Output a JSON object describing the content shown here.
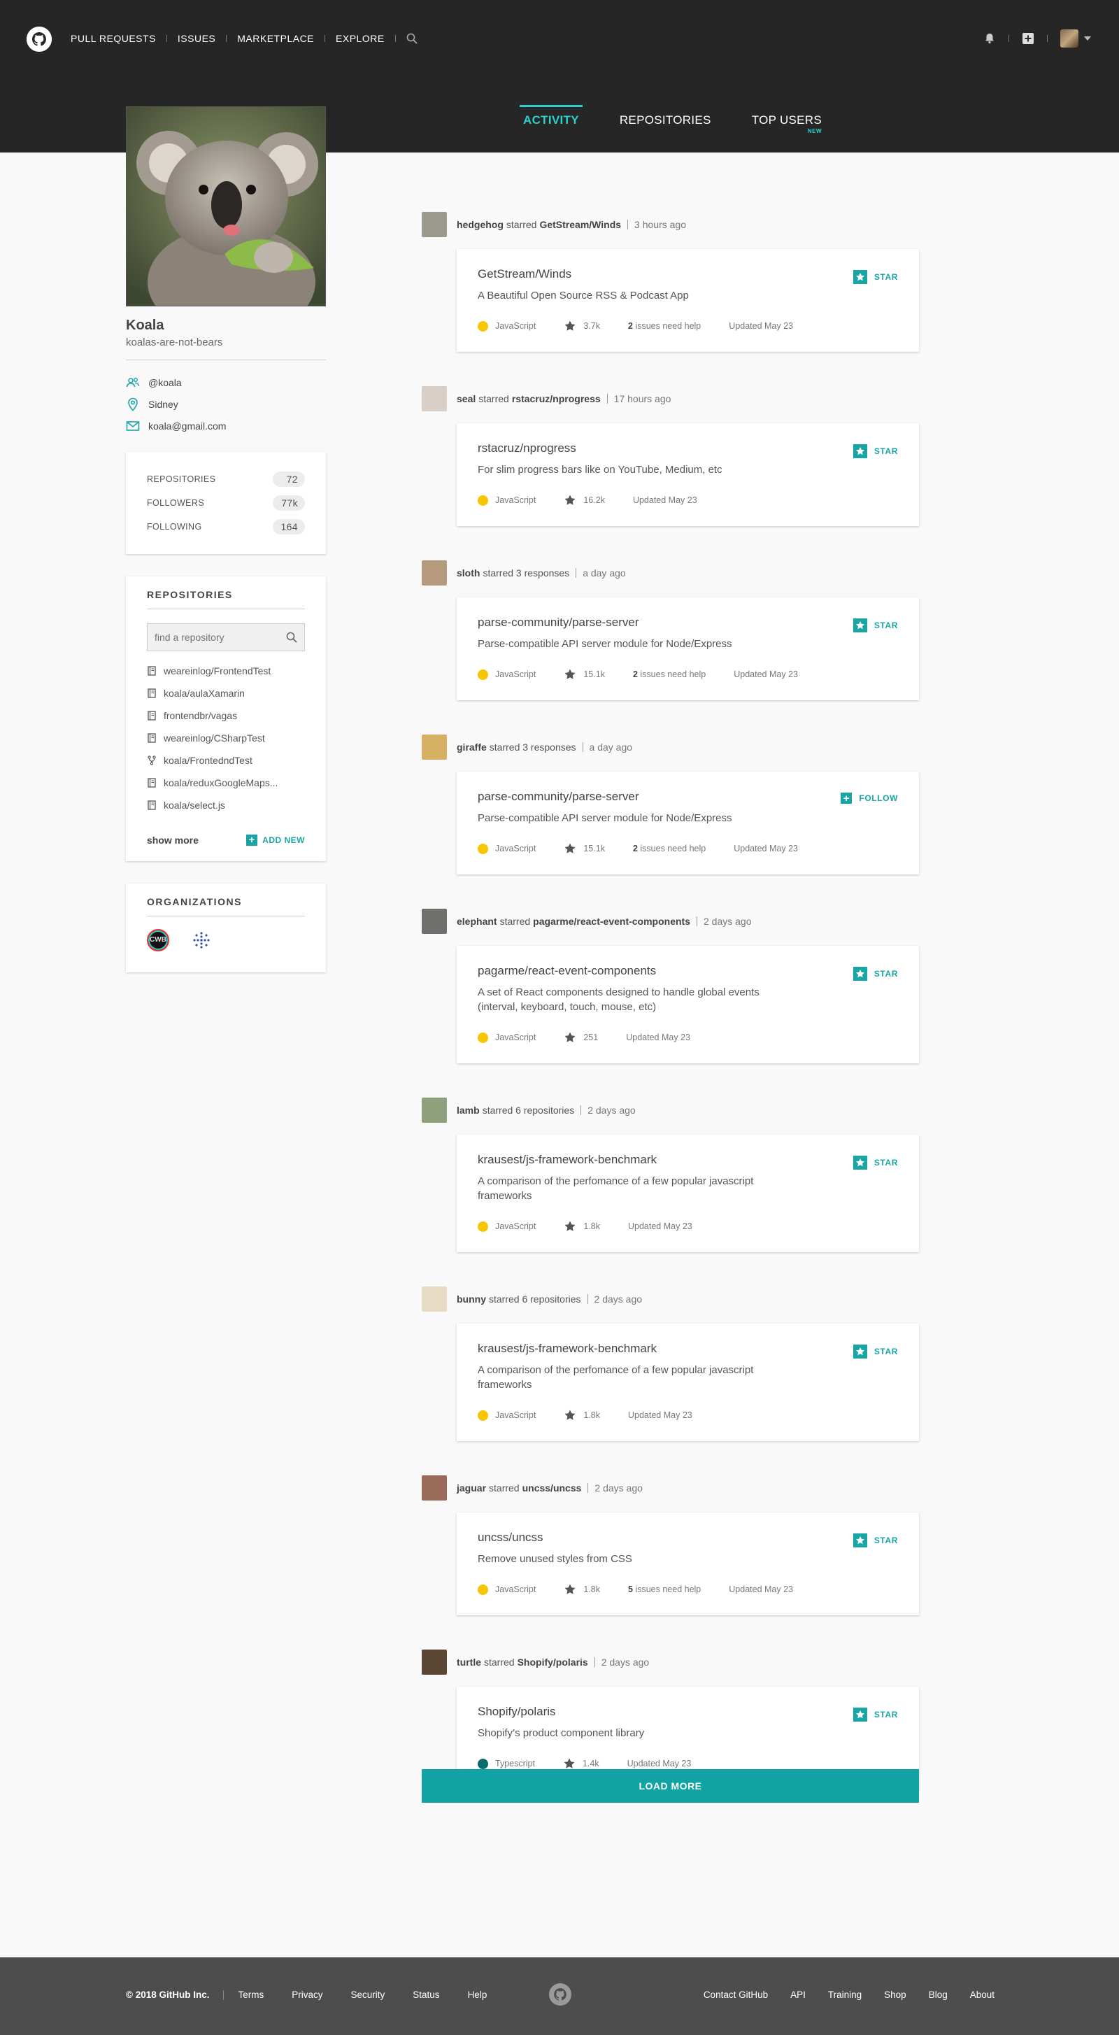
{
  "nav": {
    "items": [
      "PULL REQUESTS",
      "ISSUES",
      "MARKETPLACE",
      "EXPLORE"
    ]
  },
  "tabs": [
    {
      "label": "ACTIVITY",
      "active": true
    },
    {
      "label": "REPOSITORIES"
    },
    {
      "label": "TOP USERS",
      "badge": "NEW"
    }
  ],
  "profile": {
    "name": "Koala",
    "handle": "koalas-are-not-bears",
    "username": "@koala",
    "location": "Sidney",
    "email": "koala@gmail.com"
  },
  "stats": [
    {
      "label": "REPOSITORIES",
      "value": "72"
    },
    {
      "label": "FOLLOWERS",
      "value": "77k"
    },
    {
      "label": "FOLLOWING",
      "value": "164"
    }
  ],
  "repos": {
    "title": "REPOSITORIES",
    "search_placeholder": "find a repository",
    "items": [
      {
        "name": "weareinlog/FrontendTest",
        "icon": "repo-icon"
      },
      {
        "name": "koala/aulaXamarin",
        "icon": "repo-icon"
      },
      {
        "name": "frontendbr/vagas",
        "icon": "repo-icon"
      },
      {
        "name": "weareinlog/CSharpTest",
        "icon": "repo-icon"
      },
      {
        "name": "koala/FrontedndTest",
        "icon": "fork-icon"
      },
      {
        "name": "koala/reduxGoogleMaps...",
        "icon": "repo-icon"
      },
      {
        "name": "koala/select.js",
        "icon": "repo-icon"
      }
    ],
    "show_more": "show more",
    "add_new": "ADD NEW"
  },
  "orgs": {
    "title": "ORGANIZATIONS",
    "items": [
      "CWB"
    ]
  },
  "feed": [
    {
      "user": "hedgehog",
      "verb": "starred",
      "target": "GetStream/Winds",
      "time": "3 hours ago",
      "avatar_color": "#9a9a8c",
      "repo": "GetStream/Winds",
      "desc": "A Beautiful Open Source RSS & Podcast App",
      "lang": "JavaScript",
      "lang_color": "#f7c600",
      "stars": "3.7k",
      "issues": "2",
      "issues_text": "issues need help",
      "updated": "Updated May 23",
      "action": "STAR"
    },
    {
      "user": "seal",
      "verb": "starred",
      "target": "rstacruz/nprogress",
      "time": "17 hours ago",
      "avatar_color": "#d9cfc6",
      "repo": "rstacruz/nprogress",
      "desc": "For slim progress bars like on YouTube, Medium, etc",
      "lang": "JavaScript",
      "lang_color": "#f7c600",
      "stars": "16.2k",
      "issues": "",
      "issues_text": "",
      "updated": "Updated May 23",
      "action": "STAR"
    },
    {
      "user": "sloth",
      "verb": "starred 3 responses",
      "target": "",
      "time": "a day ago",
      "avatar_color": "#b59a7e",
      "repo": "parse-community/parse-server",
      "desc": "Parse-compatible API server module for Node/Express",
      "lang": "JavaScript",
      "lang_color": "#f7c600",
      "stars": "15.1k",
      "issues": "2",
      "issues_text": "issues need help",
      "updated": "Updated May 23",
      "action": "STAR"
    },
    {
      "user": "giraffe",
      "verb": "starred 3 responses",
      "target": "",
      "time": "a day ago",
      "avatar_color": "#d6b163",
      "repo": "parse-community/parse-server",
      "desc": "Parse-compatible API server module for Node/Express",
      "lang": "JavaScript",
      "lang_color": "#f7c600",
      "stars": "15.1k",
      "issues": "2",
      "issues_text": "issues need help",
      "updated": "Updated May 23",
      "action": "FOLLOW"
    },
    {
      "user": "elephant",
      "verb": "starred",
      "target": "pagarme/react-event-components",
      "time": "2 days ago",
      "avatar_color": "#6f6f6b",
      "repo": "pagarme/react-event-components",
      "desc": "A set of React components designed to handle global events (interval, keyboard, touch, mouse, etc)",
      "lang": "JavaScript",
      "lang_color": "#f7c600",
      "stars": "251",
      "issues": "",
      "issues_text": "",
      "updated": "Updated May 23",
      "action": "STAR"
    },
    {
      "user": "lamb",
      "verb": "starred 6 repositories",
      "target": "",
      "time": "2 days ago",
      "avatar_color": "#8ea07c",
      "repo": "krausest/js-framework-benchmark",
      "desc": "A comparison of the perfomance of a few popular javascript frameworks",
      "lang": "JavaScript",
      "lang_color": "#f7c600",
      "stars": "1.8k",
      "issues": "",
      "issues_text": "",
      "updated": "Updated May 23",
      "action": "STAR"
    },
    {
      "user": "bunny",
      "verb": "starred 6 repositories",
      "target": "",
      "time": "2 days ago",
      "avatar_color": "#e6dcc4",
      "repo": "krausest/js-framework-benchmark",
      "desc": "A comparison of the perfomance of a few popular javascript frameworks",
      "lang": "JavaScript",
      "lang_color": "#f7c600",
      "stars": "1.8k",
      "issues": "",
      "issues_text": "",
      "updated": "Updated May 23",
      "action": "STAR"
    },
    {
      "user": "jaguar",
      "verb": "starred",
      "target": "uncss/uncss",
      "time": "2 days ago",
      "avatar_color": "#9a6a5a",
      "repo": "uncss/uncss",
      "desc": "Remove unused styles from CSS",
      "lang": "JavaScript",
      "lang_color": "#f7c600",
      "stars": "1.8k",
      "issues": "5",
      "issues_text": "issues need help",
      "updated": "Updated May 23",
      "action": "STAR"
    },
    {
      "user": "turtle",
      "verb": "starred",
      "target": "Shopify/polaris",
      "time": "2 days ago",
      "avatar_color": "#5b4634",
      "repo": "Shopify/polaris",
      "desc": "Shopify’s product component library",
      "lang": "Typescript",
      "lang_color": "#0d6b6b",
      "stars": "1.4k",
      "issues": "",
      "issues_text": "",
      "updated": "Updated May 23",
      "action": "STAR"
    }
  ],
  "load_more": "LOAD MORE",
  "footer": {
    "copyright": "© 2018 GitHub Inc.",
    "left_links": [
      "Terms",
      "Privacy",
      "Security",
      "Status",
      "Help"
    ],
    "right_links": [
      "Contact GitHub",
      "API",
      "Training",
      "Shop",
      "Blog",
      "About"
    ]
  },
  "colors": {
    "accent": "#1aa5a5",
    "header_bg": "#262626",
    "footer_bg": "#4d4d4d",
    "active_tab": "#2ad1d1"
  }
}
